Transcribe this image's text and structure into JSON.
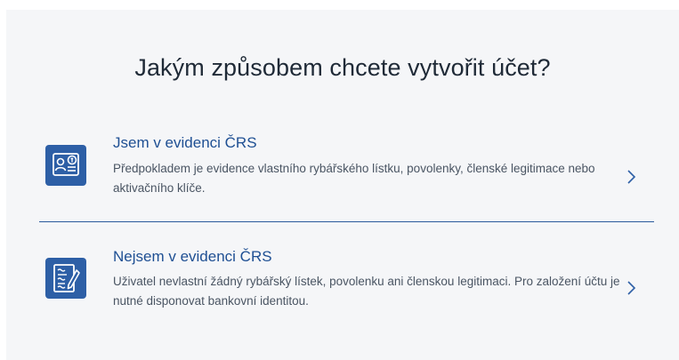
{
  "page": {
    "title": "Jakým způsobem chcete vytvořit účet?"
  },
  "options": [
    {
      "title": "Jsem v evidenci ČRS",
      "description": "Předpokladem je evidence vlastního rybářského lístku, povolenky, členské legitimace nebo aktivačního klíče.",
      "icon": "id-card-icon"
    },
    {
      "title": "Nejsem v evidenci ČRS",
      "description": "Uživatel nevlastní žádný rybářský lístek, povolenku ani členskou legitimaci. Pro založení účtu je nutné disponovat bankovní identitou.",
      "icon": "document-sign-icon"
    }
  ],
  "colors": {
    "accent": "#2d5fa6",
    "title_link": "#1e4f93",
    "background": "#f5f6f8"
  }
}
